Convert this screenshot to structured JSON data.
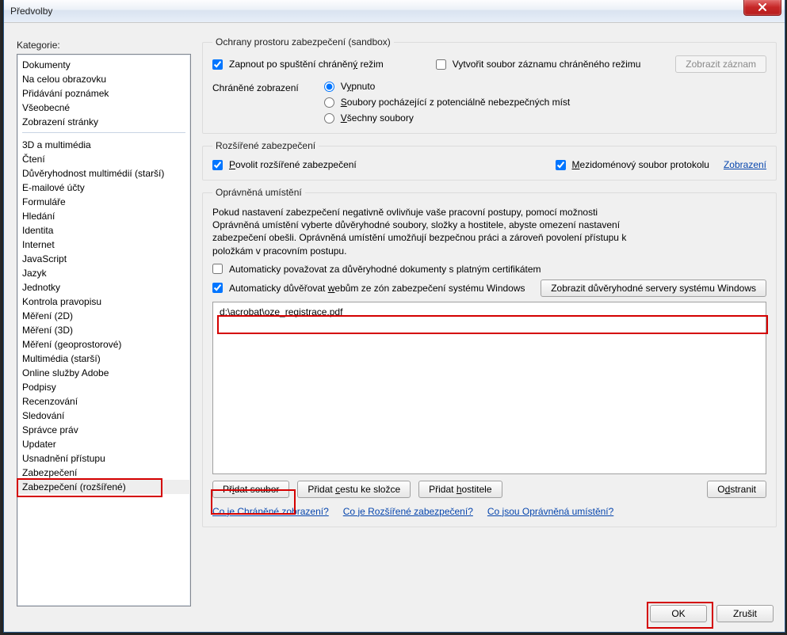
{
  "title": "Předvolby",
  "categories_label": "Kategorie:",
  "categories_top": [
    "Dokumenty",
    "Na celou obrazovku",
    "Přidávání poznámek",
    "Všeobecné",
    "Zobrazení stránky"
  ],
  "categories_bottom": [
    "3D a multimédia",
    "Čtení",
    "Důvěryhodnost multimédií (starší)",
    "E-mailové účty",
    "Formuláře",
    "Hledání",
    "Identita",
    "Internet",
    "JavaScript",
    "Jazyk",
    "Jednotky",
    "Kontrola pravopisu",
    "Měření (2D)",
    "Měření (3D)",
    "Měření (geoprostorové)",
    "Multimédia (starší)",
    "Online služby Adobe",
    "Podpisy",
    "Recenzování",
    "Sledování",
    "Správce práv",
    "Updater",
    "Usnadnění přístupu",
    "Zabezpečení",
    "Zabezpečení (rozšířené)"
  ],
  "selected_category_index": 24,
  "sandbox": {
    "legend": "Ochrany prostoru zabezpečení (sandbox)",
    "enable_protected_label_pre": "Zapnout po spuštění chráněn",
    "enable_protected_label_u": "ý",
    "enable_protected_label_post": " režim",
    "enable_protected_checked": true,
    "create_log_label": "Vytvořit soubor záznamu chráněného režimu",
    "create_log_checked": false,
    "show_log_btn": "Zobrazit záznam",
    "protected_view_label": "Chráněné zobrazení",
    "radio1_pre": "V",
    "radio1_u": "y",
    "radio1_post": "pnuto",
    "radio2_pre": "",
    "radio2_u": "S",
    "radio2_post": "oubory pocházející z potenciálně nebezpečných míst",
    "radio3_pre": "",
    "radio3_u": "V",
    "radio3_post": "šechny soubory",
    "radio_selected": 0
  },
  "extsec": {
    "legend": "Rozšířené zabezpečení",
    "enable_label_pre": "",
    "enable_label_u": "P",
    "enable_label_post": "ovolit rozšířené zabezpečení",
    "enable_checked": true,
    "crossdomain_label_pre": "",
    "crossdomain_label_u": "M",
    "crossdomain_label_post": "ezidoménový soubor protokolu",
    "crossdomain_checked": true,
    "view_link": "Zobrazení"
  },
  "priv": {
    "legend": "Oprávněná umístění",
    "desc": "Pokud nastavení zabezpečení negativně ovlivňuje vaše pracovní postupy, pomocí možnosti Oprávněná umístění vyberte důvěryhodné soubory, složky a hostitele, abyste omezení nastavení zabezpečení obešli. Oprávněná umístění umožňují bezpečnou práci a zároveň povolení přístupu k položkám v pracovním postupu.",
    "auto_trust_cert_label": "Automaticky považovat za důvěryhodné dokumenty s platným certifikátem",
    "auto_trust_cert_checked": false,
    "auto_trust_web_pre": "Automaticky důvěřovat ",
    "auto_trust_web_u": "w",
    "auto_trust_web_post": "ebům ze zón zabezpečení systému Windows",
    "auto_trust_web_checked": true,
    "show_servers_btn": "Zobrazit důvěryhodné servery systému Windows",
    "locations": [
      "d:\\acrobat\\oze_registrace.pdf"
    ],
    "add_file_btn_pre": "Př",
    "add_file_btn_u": "i",
    "add_file_btn_post": "dat soubor",
    "add_folder_btn_pre": "Přidat ",
    "add_folder_btn_u": "c",
    "add_folder_btn_post": "estu ke složce",
    "add_host_btn_pre": "Přidat ",
    "add_host_btn_u": "h",
    "add_host_btn_post": "ostitele",
    "remove_btn_pre": "O",
    "remove_btn_u": "d",
    "remove_btn_post": "stranit"
  },
  "help": {
    "l1": "Co je Chráněné zobrazení?",
    "l2": "Co je Rozšířené zabezpečení?",
    "l3": "Co jsou Oprávněná umístění?"
  },
  "footer": {
    "ok": "OK",
    "cancel": "Zrušit"
  }
}
